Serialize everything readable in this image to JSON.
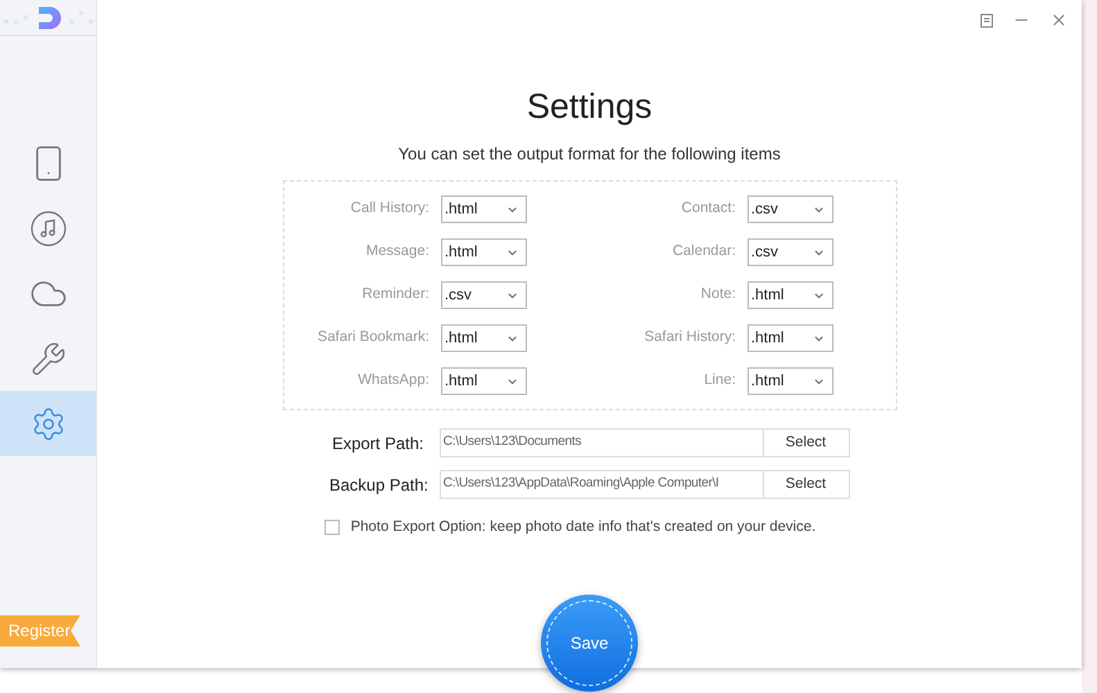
{
  "sidebar": {
    "items": [
      {
        "kind": "phone",
        "selected": false
      },
      {
        "kind": "music",
        "selected": false
      },
      {
        "kind": "cloud",
        "selected": false
      },
      {
        "kind": "tools",
        "selected": false
      },
      {
        "kind": "settings",
        "selected": true
      }
    ],
    "register": "Register"
  },
  "title": "Settings",
  "subtitle": "You can set the output format for the following items",
  "formats": [
    {
      "label": "Call History:",
      "value": ".html"
    },
    {
      "label": "Contact:",
      "value": ".csv"
    },
    {
      "label": "Message:",
      "value": ".html"
    },
    {
      "label": "Calendar:",
      "value": ".csv"
    },
    {
      "label": "Reminder:",
      "value": ".csv"
    },
    {
      "label": "Note:",
      "value": ".html"
    },
    {
      "label": "Safari Bookmark:",
      "value": ".html"
    },
    {
      "label": "Safari History:",
      "value": ".html"
    },
    {
      "label": "WhatsApp:",
      "value": ".html"
    },
    {
      "label": "Line:",
      "value": ".html"
    }
  ],
  "paths": [
    {
      "label": "Export Path:",
      "value": "C:\\Users\\123\\Documents",
      "button": "Select"
    },
    {
      "label": "Backup Path:",
      "value": "C:\\Users\\123\\AppData\\Roaming\\Apple Computer\\I",
      "button": "Select"
    }
  ],
  "photo_option": {
    "label": "Photo Export Option: keep photo date info that's created on your device.",
    "checked": false
  },
  "save": "Save"
}
